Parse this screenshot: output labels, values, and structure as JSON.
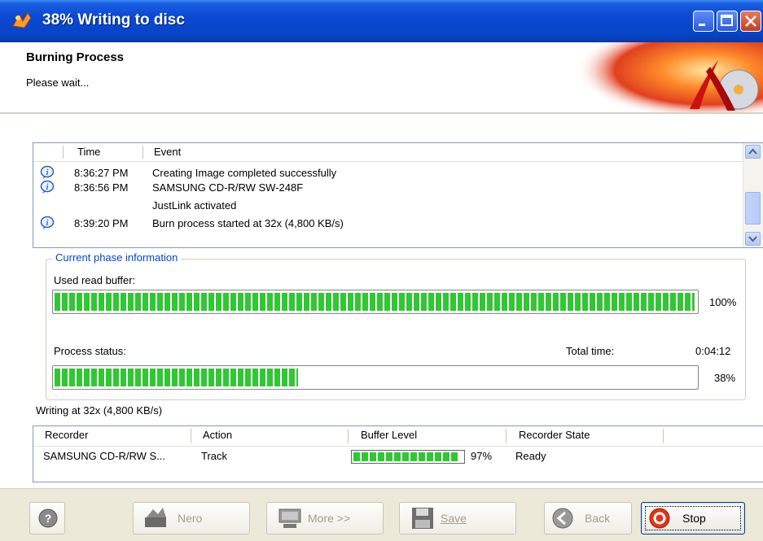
{
  "window": {
    "title": "38% Writing to disc"
  },
  "header": {
    "title": "Burning Process",
    "subtitle": "Please wait..."
  },
  "log": {
    "columns": [
      "Time",
      "Event"
    ],
    "rows": [
      {
        "time": "8:36:27 PM",
        "event": "Creating Image completed successfully",
        "icon": "info-icon"
      },
      {
        "time": "8:36:56 PM",
        "event": "SAMSUNG CD-R/RW SW-248F",
        "icon": "info-icon"
      },
      {
        "time": "",
        "event": "JustLink activated",
        "icon": ""
      },
      {
        "time": "8:39:20 PM",
        "event": "Burn process started at 32x (4,800 KB/s)",
        "icon": "info-icon"
      }
    ]
  },
  "phase": {
    "legend": "Current phase information",
    "buffer_label": "Used read buffer:",
    "buffer_value": 1.0,
    "buffer_pct": "100%",
    "status_label": "Process status:",
    "status_value": 0.38,
    "status_pct": "38%",
    "total_time_label": "Total time:",
    "total_time": "0:04:12"
  },
  "writing_speed": "Writing at 32x (4,800 KB/s)",
  "recorders": {
    "columns": [
      "Recorder",
      "Action",
      "Buffer Level",
      "Recorder State"
    ],
    "rows": [
      {
        "recorder": "SAMSUNG CD-R/RW S...",
        "action": "Track",
        "buffer_value": 0.97,
        "buffer_pct": "97%",
        "state": "Ready"
      }
    ]
  },
  "buttons": {
    "help_icon": "question-icon",
    "nero": "Nero",
    "more": "More >>",
    "save": "Save",
    "back": "Back",
    "stop": "Stop"
  },
  "colors": {
    "title_bar": "#0a48d3",
    "progress": "#2fc832",
    "legend": "#0046d5"
  }
}
